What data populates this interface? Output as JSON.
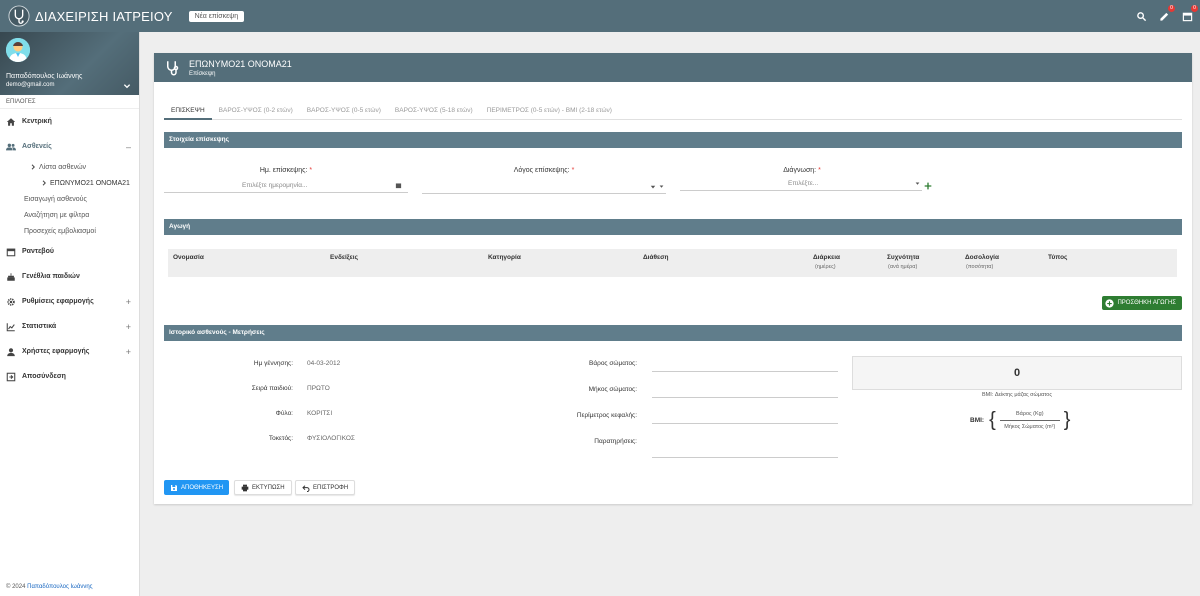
{
  "app": {
    "title": "ΔΙΑΧΕΙΡΙΣΗ ΙΑΤΡΕΙΟΥ",
    "new_visit_label": "Νέα επίσκεψη"
  },
  "topbar": {
    "pencil_badge": "0",
    "calendar_badge": "0"
  },
  "user": {
    "name": "Παπαδόπουλος Ιωάννης",
    "email": "demo@gmail.com"
  },
  "sidebar": {
    "section_label": "ΕΠΙΛΟΓΕΣ",
    "home": "Κεντρική",
    "patients": "Ασθενείς",
    "patients_list": "Λίστα ασθενών",
    "current_patient": "ΕΠΩΝΥΜΟ21 ΟΝΟΜΑ21",
    "add_patient": "Εισαγωγή ασθενούς",
    "filter_search": "Αναζήτηση με φίλτρα",
    "vaccinations": "Προσεχείς εμβολιασμοί",
    "appointments": "Ραντεβού",
    "births": "Γενέθλια παιδιών",
    "app_settings": "Ρυθμίσεις εφαρμογής",
    "statistics": "Στατιστικά",
    "app_users": "Χρήστες εφαρμογής",
    "logout": "Αποσύνδεση",
    "minus": "–",
    "plus": "+"
  },
  "footer": {
    "copyright": "© 2024 ",
    "author": "Παπαδόπουλος Ιωάννης"
  },
  "card": {
    "title": "ΕΠΩΝΥΜΟ21 ΟΝΟΜΑ21",
    "subtitle": "Επίσκεψη"
  },
  "tabs": [
    "ΕΠΙΣΚΕΨΗ",
    "ΒΑΡΟΣ-ΥΨΟΣ (0-2 ετών)",
    "ΒΑΡΟΣ-ΥΨΟΣ (0-5 ετών)",
    "ΒΑΡΟΣ-ΥΨΟΣ (5-18 ετών)",
    "ΠΕΡΙΜΕΤΡΟΣ (0-5 ετών) - BMI (2-18 ετών)"
  ],
  "visit": {
    "section_title": "Στοιχεία επίσκεψης",
    "date_label": "Ημ. επίσκεψης:",
    "date_placeholder": "Επιλέξτε ημερομηνία...",
    "reason_label": "Λόγος επίσκεψης:",
    "diagnosis_label": "Διάγνωση:",
    "diagnosis_placeholder": "Επιλέξτε...",
    "required_mark": "*"
  },
  "treatment": {
    "section_title": "Αγωγή",
    "columns": [
      "Ονομασία",
      "Ενδείξεις",
      "Κατηγορία",
      "Διάθεση",
      "Διάρκεια",
      "Συχνότητα",
      "Δοσολογία",
      "Τύπος"
    ],
    "column_units": [
      "(ημέρες)",
      "(ανά ημέρα)",
      "(ποσότητα)"
    ],
    "add_button": "ΠΡΟΣΘΗΚΗ ΑΓΩΓΗΣ"
  },
  "history": {
    "section_title": "Ιστορικό ασθενούς - Μετρήσεις",
    "birth_date_label": "Ημ γέννησης:",
    "birth_date": "04-03-2012",
    "child_order_label": "Σειρά παιδιού:",
    "child_order": "ΠΡΩΤΟ",
    "gender_label": "Φύλο:",
    "gender": "ΚΟΡΙΤΣΙ",
    "delivery_label": "Τοκετός:",
    "delivery": "ΦΥΣΙΟΛΟΓΙΚΟΣ",
    "weight_label": "Βάρος σώματος:",
    "height_label": "Μήκος σώματος:",
    "head_label": "Περίμετρος κεφαλής:",
    "notes_label": "Παρατηρήσεις:",
    "bmi_value": "0",
    "bmi_caption": "BMI: Δείκτης μάζας σώματος",
    "bmi_label": "BMI:",
    "bmi_numerator": "Βάρος (Kg)",
    "bmi_denominator": "Μήκος Σώματος (m²)"
  },
  "actions": {
    "save": "ΑΠΟΘΗΚΕΥΣΗ",
    "print": "ΕΚΤΥΠΩΣΗ",
    "back": "ΕΠΙΣΤΡΟΦΗ"
  }
}
